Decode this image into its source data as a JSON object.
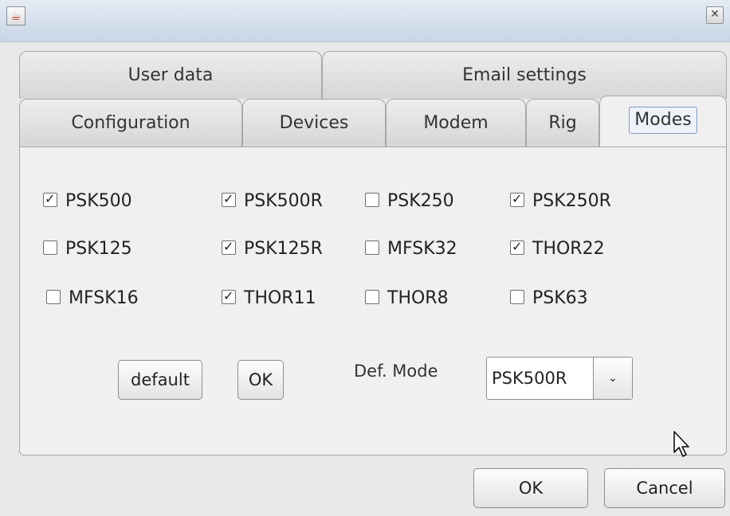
{
  "titlebar": {
    "app_icon": "java-cup-icon",
    "close_icon": "close-icon",
    "close_glyph": "✕"
  },
  "tabs_row1": [
    {
      "label": "User data"
    },
    {
      "label": "Email settings"
    }
  ],
  "tabs_row2": [
    {
      "label": "Configuration"
    },
    {
      "label": "Devices"
    },
    {
      "label": "Modem"
    },
    {
      "label": "Rig"
    },
    {
      "label": "Modes",
      "active": true
    }
  ],
  "modes": [
    {
      "label": "PSK500",
      "checked": true
    },
    {
      "label": "PSK500R",
      "checked": true
    },
    {
      "label": "PSK250",
      "checked": false
    },
    {
      "label": "PSK250R",
      "checked": true
    },
    {
      "label": "PSK125",
      "checked": false
    },
    {
      "label": "PSK125R",
      "checked": true
    },
    {
      "label": "MFSK32",
      "checked": false
    },
    {
      "label": "THOR22",
      "checked": true
    },
    {
      "label": "MFSK16",
      "checked": false
    },
    {
      "label": "THOR11",
      "checked": true
    },
    {
      "label": "THOR8",
      "checked": false
    },
    {
      "label": "PSK63",
      "checked": false
    }
  ],
  "panel_buttons": {
    "default_label": "default",
    "ok_label": "OK"
  },
  "def_mode": {
    "label": "Def. Mode",
    "value": "PSK500R",
    "arrow": "⌄"
  },
  "dialog_buttons": {
    "ok_label": "OK",
    "cancel_label": "Cancel"
  }
}
